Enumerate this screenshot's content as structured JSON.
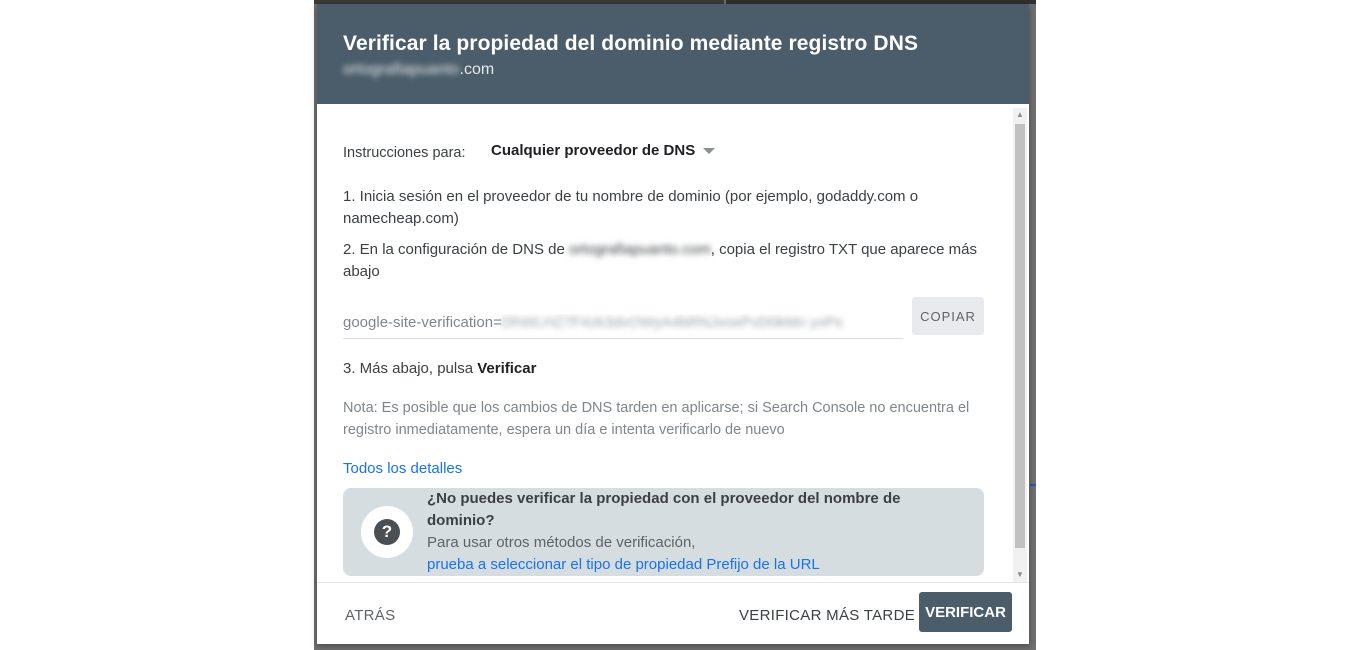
{
  "dialog": {
    "title": "Verificar la propiedad del dominio mediante registro DNS",
    "subtitle_blurred": "ortografiapuanto",
    "subtitle_suffix": ".com"
  },
  "instructions": {
    "label": "Instrucciones para:",
    "provider_selected": "Cualquier proveedor de DNS"
  },
  "steps": {
    "step1": "1. Inicia sesión en el proveedor de tu nombre de dominio (por ejemplo, godaddy.com o namecheap.com)",
    "step2_prefix": "2. En la configuración de DNS de ",
    "step2_domain_blurred": "ortografiapuanto.com",
    "step2_suffix": ", copia el registro TXT que aparece más abajo",
    "step3_prefix": "3. Más abajo, pulsa ",
    "step3_bold": "Verificar"
  },
  "txt_record": {
    "prefix": "google-site-verification=",
    "value_blurred": "DhWLHZ7F4zk3dvOWyA4bRNJvoxPvD0kMn yvPs",
    "copy_label": "COPIAR"
  },
  "note": "Nota: Es posible que los cambios de DNS tarden en aplicarse; si Search Console no encuentra el registro inmediatamente, espera un día e intenta verificarlo de nuevo",
  "details_link": "Todos los detalles",
  "help_box": {
    "title": "¿No puedes verificar la propiedad con el proveedor del nombre de dominio?",
    "description": "Para usar otros métodos de verificación,",
    "link": "prueba a seleccionar el tipo de propiedad Prefijo de la URL",
    "icon": "help-circle-icon"
  },
  "footer": {
    "back_label": "ATRÁS",
    "later_label": "VERIFICAR MÁS TARDE",
    "verify_label": "VERIFICAR"
  },
  "colors": {
    "header_bg": "#4b5d6a",
    "link": "#1a73e8",
    "help_box_bg": "#d5dde1"
  }
}
